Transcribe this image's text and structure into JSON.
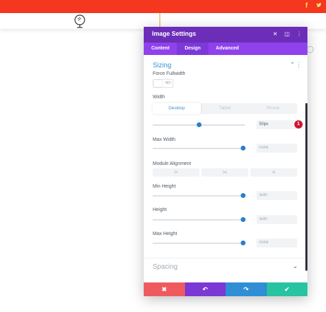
{
  "social": {
    "facebook_glyph": "f",
    "twitter_glyph": "🐦"
  },
  "modal": {
    "title": "Image Settings",
    "header_icons": [
      "close-icon",
      "expand-icon",
      "more-icon"
    ],
    "tabs": [
      {
        "label": "Content",
        "active": false
      },
      {
        "label": "Design",
        "active": true
      },
      {
        "label": "Advanced",
        "active": false
      }
    ],
    "sections": {
      "sizing": {
        "title": "Sizing",
        "force_fullwidth": {
          "label": "Force Fullwidth",
          "value": "NO"
        },
        "width": {
          "label": "Width",
          "devices": [
            "Desktop",
            "Tablet",
            "Phone"
          ],
          "active_device": "Desktop",
          "value": "50px",
          "slider_fraction": 0.5,
          "badge": "1"
        },
        "max_width": {
          "label": "Max Width",
          "value": "none",
          "slider_fraction": 0.98
        },
        "module_alignment": {
          "label": "Module Alignment",
          "options": [
            "align-left-icon",
            "align-center-icon",
            "align-right-icon"
          ]
        },
        "min_height": {
          "label": "Min Height",
          "value": "auto",
          "slider_fraction": 0.98
        },
        "height": {
          "label": "Height",
          "value": "auto",
          "slider_fraction": 0.98
        },
        "max_height": {
          "label": "Max Height",
          "value": "none",
          "slider_fraction": 0.98
        }
      },
      "spacing": {
        "title": "Spacing"
      }
    },
    "footer": {
      "cancel": "✖",
      "undo": "↶",
      "redo": "↷",
      "save": "✔"
    }
  },
  "colors": {
    "topbar": "#f4371e",
    "modal_header": "#6c2eb9",
    "modal_tabs": "#8f42ec",
    "accent_blue": "#3b8fd1",
    "badge_red": "#d0142f"
  }
}
